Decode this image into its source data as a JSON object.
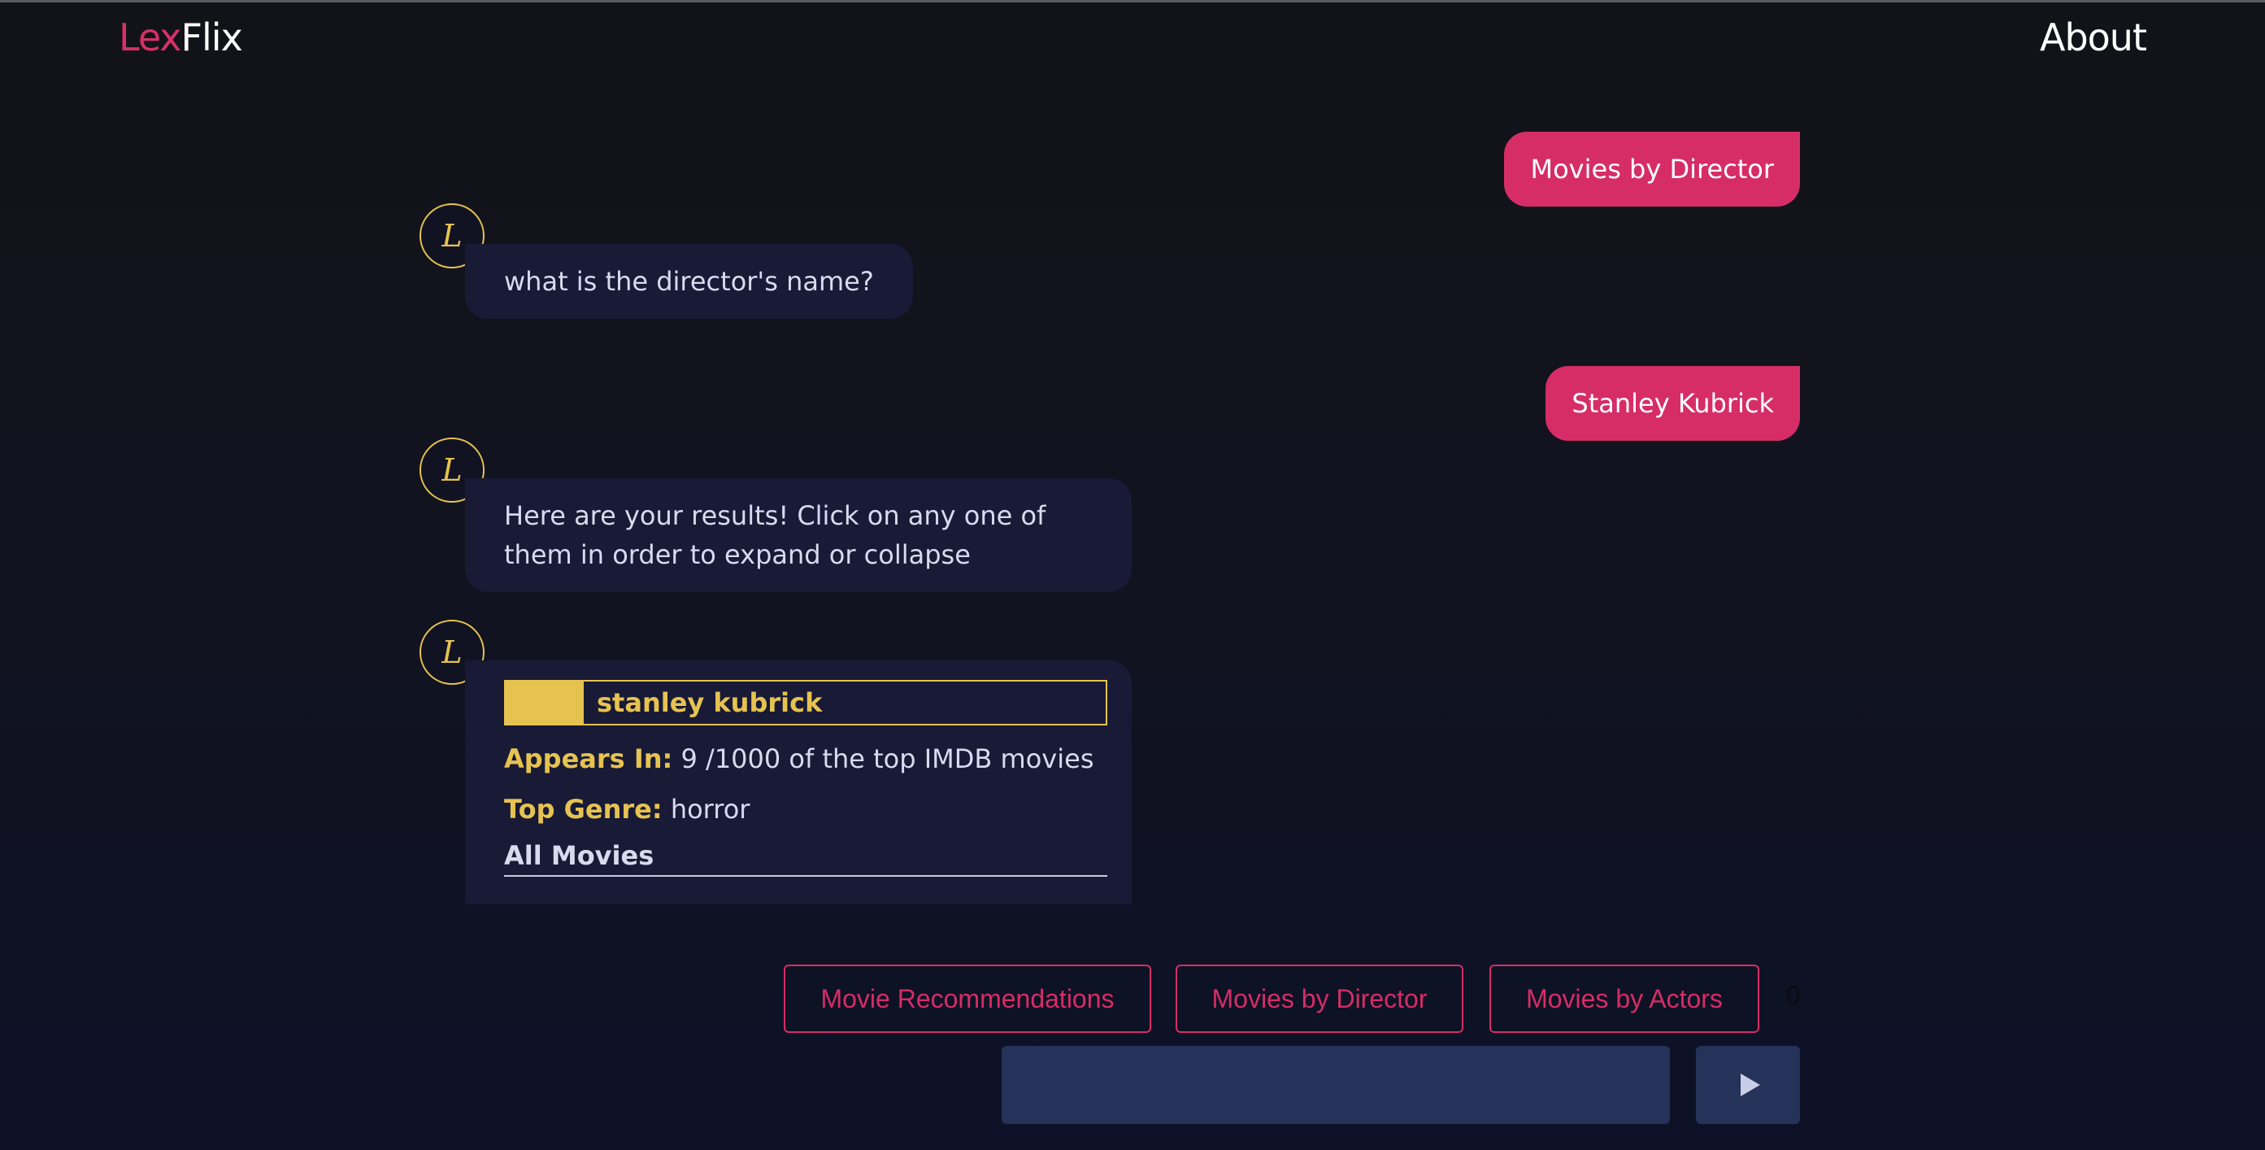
{
  "header": {
    "logo_part1": "Lex",
    "logo_part2": "Flix",
    "about_label": "About"
  },
  "messages": {
    "user_1": "Movies by Director",
    "bot_avatar_letter": "L",
    "bot_1": "what is the director's name?",
    "user_2": "Stanley Kubrick",
    "bot_2": "Here are your results! Click on any one of them in order to expand or collapse"
  },
  "result_card": {
    "name": "stanley kubrick",
    "appears_in_label": "Appears In:",
    "appears_in_value": "9 /1000 of the top IMDB movies",
    "top_genre_label": "Top Genre:",
    "top_genre_value": "horror",
    "all_movies_label": "All Movies"
  },
  "quick_replies": {
    "items": [
      "Movie Recommendations",
      "Movies by Director",
      "Movies by Actors"
    ],
    "count": "0"
  },
  "composer": {
    "value": "",
    "placeholder": ""
  },
  "icons": {
    "send": "play-triangle-icon"
  },
  "colors": {
    "accent_pink": "#d62d66",
    "accent_gold": "#e6c350",
    "bot_bubble": "#181a36",
    "input_bg": "#253259"
  }
}
